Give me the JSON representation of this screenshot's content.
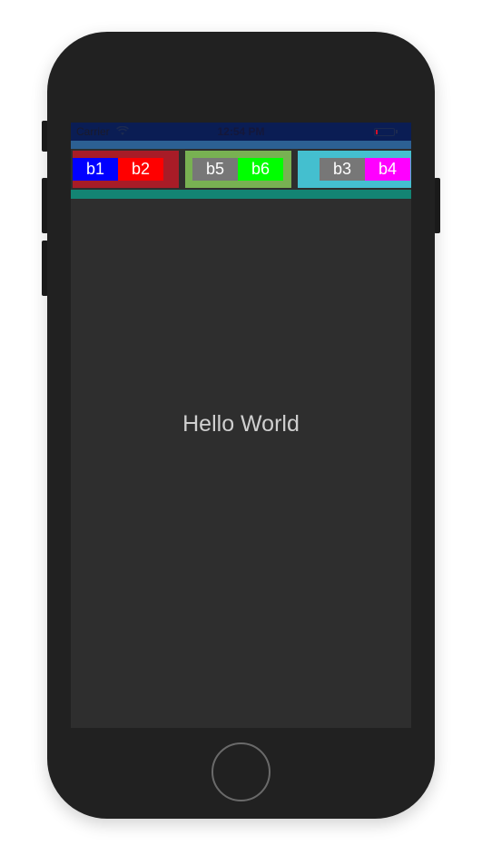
{
  "device": {
    "frame_color": "#212121",
    "home_button_icon": "home-button"
  },
  "status_bar": {
    "carrier": "Carrier",
    "wifi_icon": "wifi-icon",
    "time": "12:54 PM",
    "battery_icon": "battery-icon",
    "background": "#0a1d54"
  },
  "colors": {
    "top_strip": "#2c6093",
    "bottom_strip": "#138473",
    "screen_bg": "#2e2e2e"
  },
  "button_groups": [
    {
      "container_color": "#a81c27",
      "buttons": [
        {
          "label": "b1",
          "color": "#0000ff"
        },
        {
          "label": "b2",
          "color": "#ff0000"
        }
      ]
    },
    {
      "container_color": "#78b152",
      "buttons": [
        {
          "label": "b5",
          "color": "#777777"
        },
        {
          "label": "b6",
          "color": "#00ff00"
        }
      ]
    },
    {
      "container_color": "#44bfcf",
      "buttons": [
        {
          "label": "b3",
          "color": "#777777"
        },
        {
          "label": "b4",
          "color": "#ff00ff"
        }
      ]
    }
  ],
  "main": {
    "title": "Hello World"
  }
}
